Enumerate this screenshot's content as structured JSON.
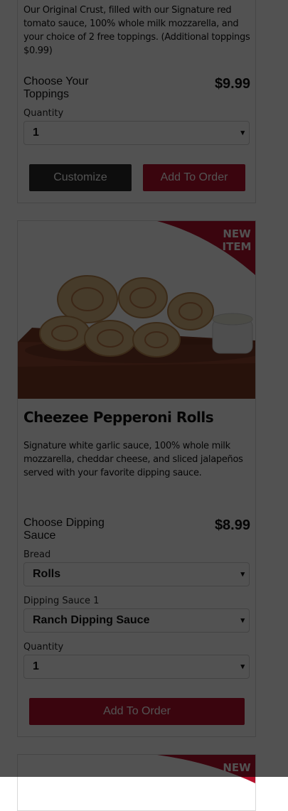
{
  "products": [
    {
      "description": "Our Original Crust, filled with our Signature red tomato sauce, 100% whole milk mozzarella, and your choice of 2 free toppings. (Additional toppings $0.99)",
      "choose_label": "Choose Your Toppings",
      "price": "$9.99",
      "quantity_label": "Quantity",
      "quantity_value": "1",
      "customize_label": "Customize",
      "add_label": "Add To Order"
    },
    {
      "badge": "NEW ITEM",
      "title": "Cheezee Pepperoni Rolls",
      "description": "Signature white garlic sauce, 100% whole milk mozzarella, cheddar cheese, and sliced jalapeños served with your favorite dipping sauce.",
      "choose_label": "Choose Dipping Sauce",
      "price": "$8.99",
      "bread_label": "Bread",
      "bread_value": "Rolls",
      "sauce_label": "Dipping Sauce 1",
      "sauce_value": "Ranch Dipping Sauce",
      "quantity_label": "Quantity",
      "quantity_value": "1",
      "add_label": "Add To Order"
    },
    {
      "badge": "NEW"
    }
  ],
  "colors": {
    "brand_red": "#b5122d",
    "dark_button": "#2b2b2b",
    "overlay": "rgba(0,0,0,0.68)"
  },
  "icons": {
    "select_arrow": "chevron-down-icon"
  }
}
